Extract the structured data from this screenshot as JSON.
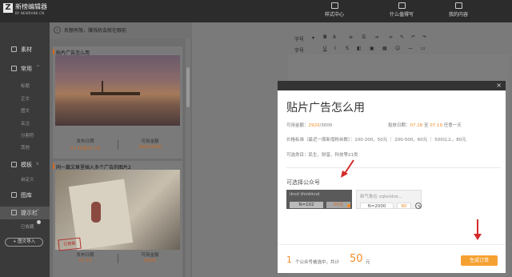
{
  "app": {
    "brand": "新榜编辑器",
    "brand_sub": "BY NEWRANK.CN"
  },
  "topnav": [
    {
      "label": "样式中心"
    },
    {
      "label": "什么值得写"
    },
    {
      "label": "我的内容"
    }
  ],
  "sidebar": {
    "items": [
      {
        "label": "素材"
      },
      {
        "label": "常用",
        "chevron": "^"
      },
      {
        "label": "模板",
        "chevron": "v"
      },
      {
        "label": "图库"
      },
      {
        "label": "提示栏",
        "chevron": "^"
      }
    ],
    "sub_changyong": [
      "标题",
      "正文",
      "图文",
      "关注",
      "分割符",
      "其他"
    ],
    "sub_muban": [
      "自定义"
    ],
    "sub_tishi": [
      "已收藏"
    ],
    "import_label": "+ 图文导入"
  },
  "panel": {
    "header_text": "名额有限，赚钱机会就在眼前",
    "cards": [
      {
        "title": "贴片广告怎么用",
        "publish_label": "发布日期",
        "publish_value": "07.18至07.19",
        "usable_label": "可用金额",
        "usable_value": "2920/3000"
      },
      {
        "title": "同一篇文章里插入多个广告的图片2",
        "stamp": "已售罄",
        "publish_label": "发布日期",
        "publish_value": "07.13",
        "usable_label": "可用金额",
        "usable_value": "0/500"
      }
    ]
  },
  "toolbar": {
    "style_label": "字号",
    "size_label": "字号"
  },
  "modal": {
    "title": "贴片广告怎么用",
    "usable_label": "可用金额：",
    "usable_value": "2920",
    "usable_total": "/3000",
    "date_label": "投放日期：",
    "date_from": "07.18",
    "date_mid": "至",
    "date_to": "07.19",
    "date_suffix": "任意一天",
    "price_label": "价格标准（最近一周新增粉丝数）：",
    "price_tiers": "100-200，50元 ｜ 200-500，60元 ｜ 500以上，80元",
    "category_label": "可选类目：",
    "category_value": "民生、财富、科技等21类",
    "pick_label": "可选择公众号",
    "accounts": [
      {
        "name": "iknd  thinkknd",
        "fans": "N=102",
        "price": "50元",
        "selected": true
      },
      {
        "name": "新气象在  zqkeldos...",
        "fans": "N=2000",
        "price": "80",
        "selected": false
      }
    ],
    "footer": {
      "count": "1",
      "text1": "个公众号被选中，共计",
      "total": "50",
      "text2": "元",
      "order_label": "生成订单"
    },
    "colors": {
      "accent": "#f08c28",
      "button": "#f5a131"
    }
  }
}
